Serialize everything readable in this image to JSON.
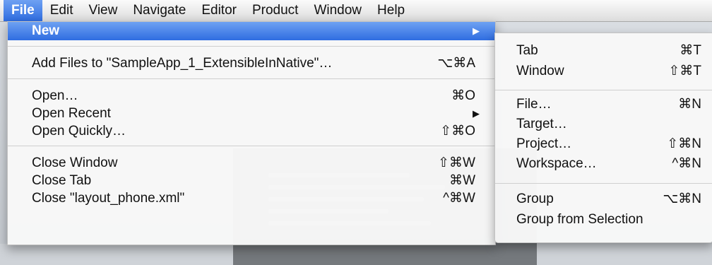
{
  "menubar": {
    "items": [
      "File",
      "Edit",
      "View",
      "Navigate",
      "Editor",
      "Product",
      "Window",
      "Help"
    ],
    "active_index": 0
  },
  "file_menu": {
    "items": [
      {
        "label": "New",
        "shortcut": "",
        "arrow": "▶"
      },
      {
        "label": "Add Files to \"SampleApp_1_ExtensibleInNative\"…",
        "shortcut": "⌥⌘A"
      },
      {
        "label": "Open…",
        "shortcut": "⌘O"
      },
      {
        "label": "Open Recent",
        "shortcut": "",
        "arrow": "▶"
      },
      {
        "label": "Open Quickly…",
        "shortcut": "⇧⌘O"
      },
      {
        "label": "Close Window",
        "shortcut": "⇧⌘W"
      },
      {
        "label": "Close Tab",
        "shortcut": "⌘W"
      },
      {
        "label": "Close \"layout_phone.xml\"",
        "shortcut": "^⌘W"
      }
    ]
  },
  "new_submenu": {
    "items": [
      {
        "label": "Tab",
        "shortcut": "⌘T"
      },
      {
        "label": "Window",
        "shortcut": "⇧⌘T"
      },
      {
        "label": "File…",
        "shortcut": "⌘N"
      },
      {
        "label": "Target…",
        "shortcut": ""
      },
      {
        "label": "Project…",
        "shortcut": "⇧⌘N"
      },
      {
        "label": "Workspace…",
        "shortcut": "^⌘N"
      },
      {
        "label": "Group",
        "shortcut": "⌥⌘N"
      },
      {
        "label": "Group from Selection",
        "shortcut": ""
      }
    ]
  },
  "colors": {
    "highlight": "#2f6de1",
    "menubar": "#e6e6e6"
  }
}
